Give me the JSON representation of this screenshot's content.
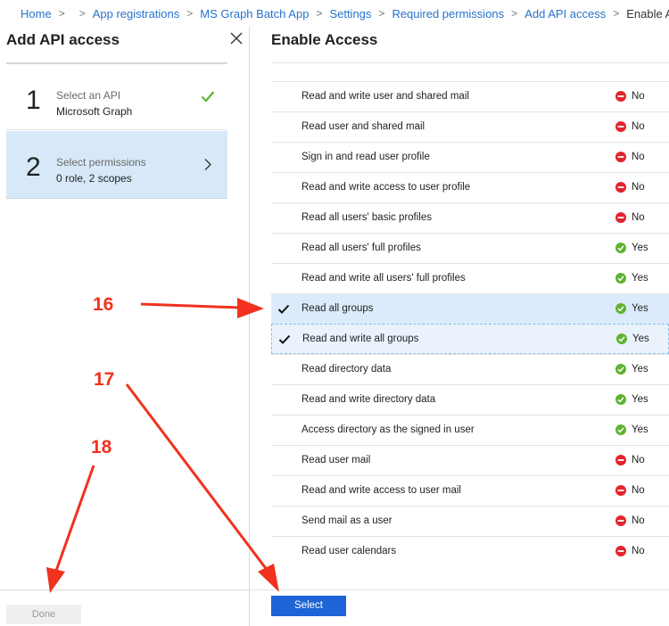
{
  "breadcrumb": {
    "home": "Home",
    "app_registrations": "App registrations",
    "app_name": "MS Graph Batch App",
    "settings": "Settings",
    "required_permissions": "Required permissions",
    "add_api_access": "Add API access",
    "current": "Enable Acc"
  },
  "left": {
    "title": "Add API access",
    "steps": [
      {
        "number": "1",
        "label": "Select an API",
        "value": "Microsoft Graph"
      },
      {
        "number": "2",
        "label": "Select permissions",
        "value": "0 role, 2 scopes"
      }
    ],
    "done_label": "Done"
  },
  "right": {
    "title": "Enable Access",
    "select_label": "Select",
    "permissions": [
      {
        "name": "Read and write user and shared mail",
        "admin": "No",
        "checked": false
      },
      {
        "name": "Read user and shared mail",
        "admin": "No",
        "checked": false
      },
      {
        "name": "Sign in and read user profile",
        "admin": "No",
        "checked": false
      },
      {
        "name": "Read and write access to user profile",
        "admin": "No",
        "checked": false
      },
      {
        "name": "Read all users' basic profiles",
        "admin": "No",
        "checked": false
      },
      {
        "name": "Read all users' full profiles",
        "admin": "Yes",
        "checked": false
      },
      {
        "name": "Read and write all users' full profiles",
        "admin": "Yes",
        "checked": false
      },
      {
        "name": "Read all groups",
        "admin": "Yes",
        "checked": true
      },
      {
        "name": "Read and write all groups",
        "admin": "Yes",
        "checked": true
      },
      {
        "name": "Read directory data",
        "admin": "Yes",
        "checked": false
      },
      {
        "name": "Read and write directory data",
        "admin": "Yes",
        "checked": false
      },
      {
        "name": "Access directory as the signed in user",
        "admin": "Yes",
        "checked": false
      },
      {
        "name": "Read user mail",
        "admin": "No",
        "checked": false
      },
      {
        "name": "Read and write access to user mail",
        "admin": "No",
        "checked": false
      },
      {
        "name": "Send mail as a user",
        "admin": "No",
        "checked": false
      },
      {
        "name": "Read user calendars",
        "admin": "No",
        "checked": false
      }
    ]
  },
  "annotations": {
    "a16": "16",
    "a17": "17",
    "a18": "18"
  },
  "colors": {
    "link": "#2672cc",
    "accent": "#1e64d6",
    "selected_row": "#dcebfb",
    "yes": "#5fb330",
    "no": "#e3242b",
    "arrow": "#f0321e"
  },
  "icons": {
    "close": "close-icon",
    "check": "check-icon",
    "chevron": "chevron-right-icon",
    "yes": "yes-check-circle-icon",
    "no": "no-minus-circle-icon"
  }
}
